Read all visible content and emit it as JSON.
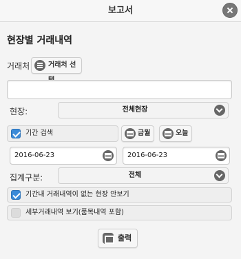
{
  "window": {
    "title": "보고서"
  },
  "heading": "현장별 거래내역",
  "client": {
    "label": "거래처",
    "button_label": "거래처 선택",
    "input_value": ""
  },
  "site": {
    "label": "현장:",
    "selected": "전체현장"
  },
  "period": {
    "checkbox_label": "기간 검색",
    "checked": true,
    "this_month_label": "금월",
    "today_label": "오늘",
    "start_date": "2016-06-23",
    "end_date": "2016-06-23"
  },
  "category": {
    "label": "집계구분:",
    "selected": "전체"
  },
  "options": [
    {
      "label": "기간내 거래내역이 없는 현장 안보기",
      "checked": true
    },
    {
      "label": "세부거래내역 보기(품목내역 포함)",
      "checked": false
    }
  ],
  "print_button_label": "출력"
}
